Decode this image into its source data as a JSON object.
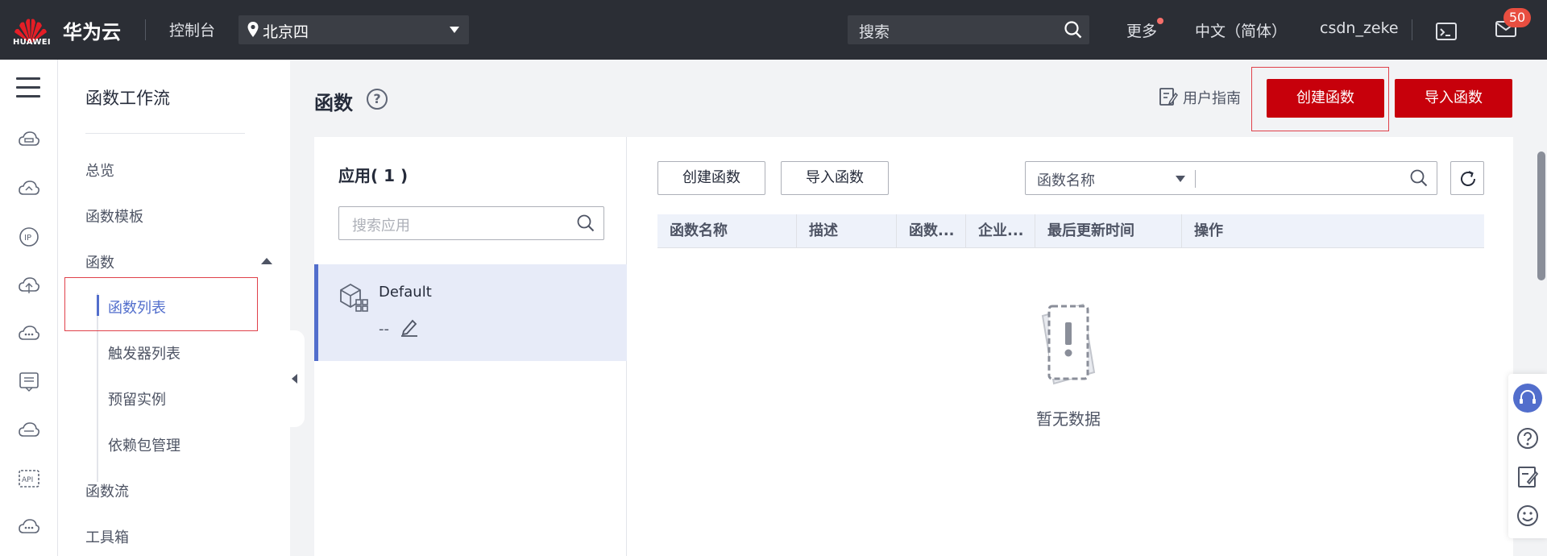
{
  "topbar": {
    "logo_text": "HUAWEI",
    "brand": "华为云",
    "console": "控制台",
    "region": "北京四",
    "search_placeholder": "搜索",
    "more": "更多",
    "language": "中文（简体）",
    "username": "csdn_zeke",
    "message_count": "50"
  },
  "rail": {
    "icons": [
      "menu-icon",
      "cloud-server-icon",
      "cloud-icon",
      "ip-icon",
      "cloud-upload-icon",
      "cloud-more-icon",
      "monitor-list-icon",
      "cloud-storage-icon",
      "api-icon",
      "cloud-dots-icon"
    ]
  },
  "side": {
    "title": "函数工作流",
    "items": {
      "overview": "总览",
      "templates": "函数模板",
      "functions": "函数",
      "function_list": "函数列表",
      "trigger_list": "触发器列表",
      "reserved_instances": "预留实例",
      "dependencies": "依赖包管理",
      "function_flow": "函数流",
      "toolbox": "工具箱"
    }
  },
  "main": {
    "title": "函数",
    "user_guide": "用户指南",
    "create_function": "创建函数",
    "import_function": "导入函数"
  },
  "apps": {
    "header": "应用( 1 )",
    "search_placeholder": "搜索应用",
    "items": [
      {
        "name": "Default",
        "description": "--"
      }
    ]
  },
  "functions": {
    "create_button": "创建函数",
    "import_button": "导入函数",
    "filter_field": "函数名称",
    "columns": [
      "函数名称",
      "描述",
      "函数...",
      "企业...",
      "最后更新时间",
      "操作"
    ],
    "empty_text": "暂无数据"
  },
  "colors": {
    "topbar_bg": "#2b2e35",
    "primary_red": "#c7000b",
    "accent_blue": "#526ecc",
    "badge_red": "#e84e40"
  }
}
